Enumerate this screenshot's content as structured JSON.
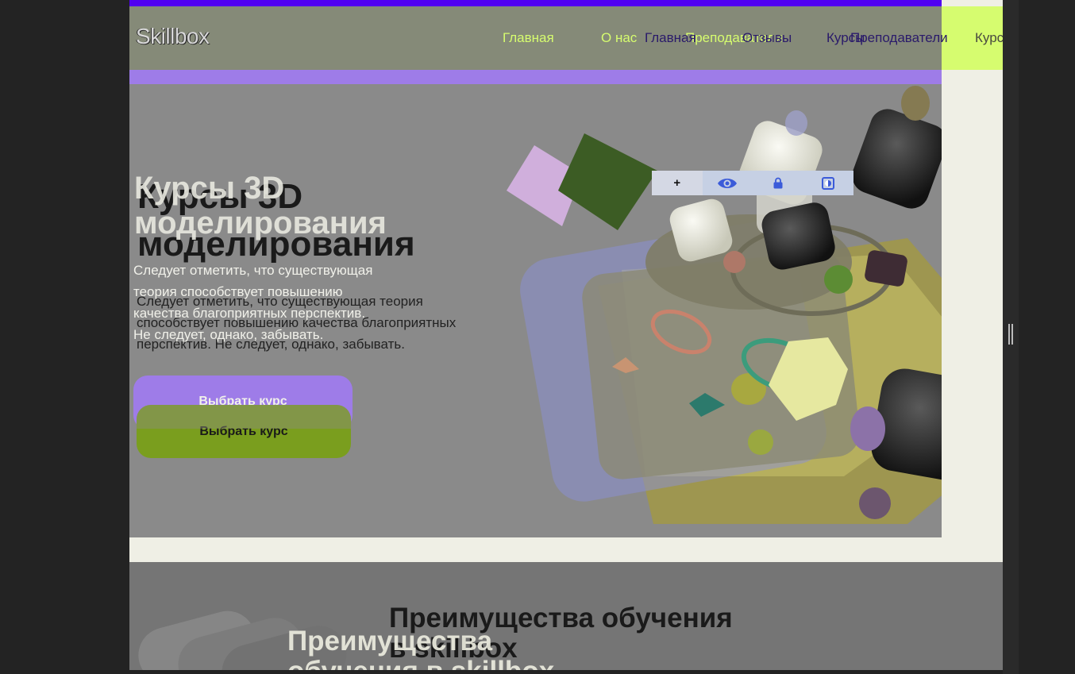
{
  "app": {
    "logo": "Skillbox"
  },
  "nav": {
    "overlay_items": [
      "Главная",
      "О нас",
      "Преподаватели"
    ],
    "underlay_items": [
      "Главная",
      "Отзывы",
      "Курсы",
      "Преподаватели",
      "Курсы"
    ]
  },
  "hero": {
    "title_line1": "Курсы 3D",
    "title_line2": "моделирования",
    "overlay_paragraph": [
      "Следует отметить, что существующая",
      "теория способствует повышению",
      "качества благоприятных перспектив.",
      "Не следует, однако, забывать."
    ],
    "underlay_paragraph": [
      "Следует отметить, что существующая теория",
      "способствует повышению качества благоприятных",
      "перспектив. Не следует, однако, забывать."
    ],
    "button_label": "Выбрать курс"
  },
  "toolbar": {
    "icons": [
      "plus-icon",
      "eye-icon",
      "lock-icon",
      "contrast-icon"
    ],
    "plus_glyph": "+"
  },
  "benefits": {
    "title_line1": "Преимущества обучения",
    "title_line2": "в skillbox",
    "overlay_title_line1": "Преимущества",
    "overlay_title_line2": "обучения в skillbox"
  },
  "colors": {
    "accent_green": "#d6fc6f",
    "accent_purple": "#9e7ce8",
    "brand_blue": "#5000f0",
    "button_green": "#7a9e1e"
  }
}
